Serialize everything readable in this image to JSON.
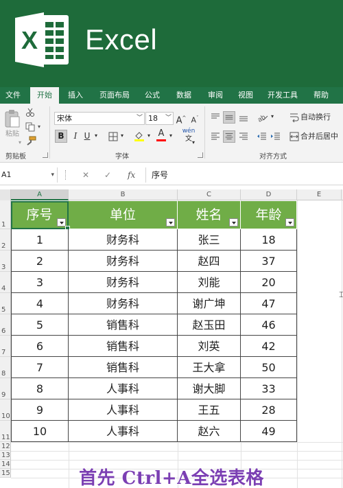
{
  "banner": {
    "app_name": "Excel",
    "logo_letter": "X",
    "colors": {
      "banner": "#1e6b3a",
      "logo": "#217346"
    }
  },
  "ribbon_tabs": [
    {
      "label": "文件",
      "active": false
    },
    {
      "label": "开始",
      "active": true
    },
    {
      "label": "插入",
      "active": false
    },
    {
      "label": "页面布局",
      "active": false
    },
    {
      "label": "公式",
      "active": false
    },
    {
      "label": "数据",
      "active": false
    },
    {
      "label": "审阅",
      "active": false
    },
    {
      "label": "视图",
      "active": false
    },
    {
      "label": "开发工具",
      "active": false
    },
    {
      "label": "帮助",
      "active": false
    }
  ],
  "ribbon": {
    "clipboard": {
      "paste_label": "粘贴",
      "group_label": "剪贴板"
    },
    "font": {
      "font_name": "宋体",
      "font_size": "18",
      "grow_label": "A",
      "shrink_label": "A",
      "bold_label": "B",
      "italic_label": "I",
      "underline_label": "U",
      "font_color_label": "A",
      "phonetic_label": "wén",
      "group_label": "字体"
    },
    "alignment": {
      "wrap_text_label": "自动换行",
      "merge_center_label": "合并后居中",
      "group_label": "对齐方式"
    }
  },
  "formula_bar": {
    "name_box": "A1",
    "cancel_symbol": "✕",
    "enter_symbol": "✓",
    "fx_symbol": "fx",
    "formula": "序号"
  },
  "sheet": {
    "column_headers": [
      "A",
      "B",
      "C",
      "D",
      "E"
    ],
    "row_headers": [
      "1",
      "2",
      "3",
      "4",
      "5",
      "6",
      "7",
      "8",
      "9",
      "10",
      "11",
      "12",
      "13",
      "14",
      "15"
    ],
    "table": {
      "header": [
        "序号",
        "单位",
        "姓名",
        "年龄"
      ],
      "header_color": "#70ad47",
      "rows": [
        [
          "1",
          "财务科",
          "张三",
          "18"
        ],
        [
          "2",
          "财务科",
          "赵四",
          "37"
        ],
        [
          "3",
          "财务科",
          "刘能",
          "20"
        ],
        [
          "4",
          "财务科",
          "谢广坤",
          "47"
        ],
        [
          "5",
          "销售科",
          "赵玉田",
          "46"
        ],
        [
          "6",
          "销售科",
          "刘英",
          "42"
        ],
        [
          "7",
          "销售科",
          "王大拿",
          "50"
        ],
        [
          "8",
          "人事科",
          "谢大脚",
          "33"
        ],
        [
          "9",
          "人事科",
          "王五",
          "28"
        ],
        [
          "10",
          "人事科",
          "赵六",
          "49"
        ]
      ]
    }
  },
  "caption": {
    "text": "首先 Ctrl+A全选表格",
    "color": "#7b3fb3"
  }
}
